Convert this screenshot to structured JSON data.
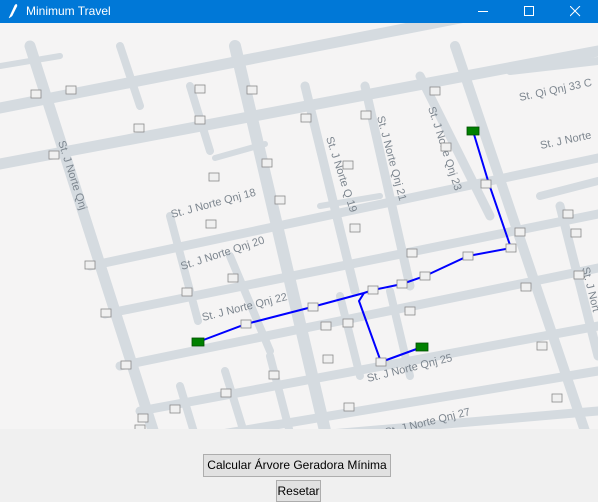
{
  "window": {
    "title": "Minimum Travel",
    "app_icon": "feather-icon"
  },
  "controls": {
    "calculate_label": "Calcular Árvore Geradora Mínima",
    "reset_label": "Resetar"
  },
  "map": {
    "street_labels": [
      "St. J Norte Qnj",
      "St. J Norte Qnj 18",
      "St. J Norte Qnj 20",
      "St. J Norte Qnj 22",
      "St. J Norte Q 19",
      "St. J Norte Qnj 21",
      "St. J Norte Qnj 23",
      "St. Qi Qnj 33 C",
      "St. J Norte",
      "St. J Norte Qnj 25",
      "St. J Norte Qnj 27",
      "St. J Nort"
    ],
    "colors": {
      "road": "#d5dbe0",
      "background": "#f5f4f4",
      "route": "#0000ff",
      "node": "#f0f0f0",
      "selected_node": "#008000"
    }
  }
}
